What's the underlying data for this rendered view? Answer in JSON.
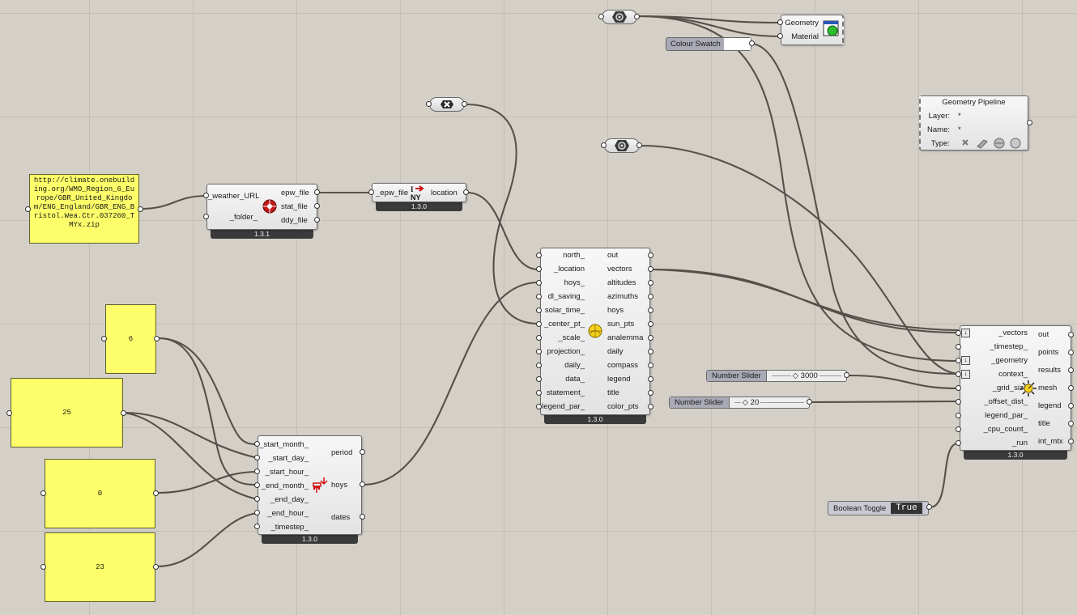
{
  "panels": {
    "url": "http://climate.onebuilding.org/WMO_Region_6_Europe/GBR_United_Kingdom/ENG_England/GBR_ENG_Bristol.Wea.Ctr.037260_TMYx.zip",
    "start_month": "6",
    "start_day": "25",
    "start_hour": "0",
    "end_hour": "23"
  },
  "download": {
    "inputs": [
      "_weather_URL",
      "_folder_"
    ],
    "outputs": [
      "epw_file",
      "stat_file",
      "ddy_file"
    ],
    "version": "1.3.1"
  },
  "import_epw": {
    "input": "_epw_file",
    "output": "location",
    "version": "1.3.0"
  },
  "period": {
    "inputs": [
      "_start_month_",
      "_start_day_",
      "_start_hour_",
      "_end_month_",
      "_end_day_",
      "_end_hour_",
      "_timestep_"
    ],
    "outputs": [
      "period",
      "hoys",
      "dates"
    ],
    "version": "1.3.0"
  },
  "sunpath": {
    "inputs": [
      "north_",
      "_location",
      "hoys_",
      "dl_saving_",
      "solar_time_",
      "_center_pt_",
      "_scale_",
      "projection_",
      "daily_",
      "data_",
      "statement_",
      "legend_par_"
    ],
    "outputs": [
      "out",
      "vectors",
      "altitudes",
      "azimuths",
      "hoys",
      "sun_pts",
      "analemma",
      "daily",
      "compass",
      "legend",
      "title",
      "color_pts"
    ],
    "version": "1.3.0"
  },
  "analysis": {
    "inputs": [
      "_vectors",
      "_timestep_",
      "_geometry",
      "context_",
      "_grid_size",
      "_offset_dist_",
      "legend_par_",
      "_cpu_count_",
      "_run"
    ],
    "outputs": [
      "out",
      "points",
      "results",
      "mesh",
      "legend",
      "title",
      "int_mtx"
    ],
    "version": "1.3.0"
  },
  "preview": {
    "inputs": [
      "Geometry",
      "Material"
    ]
  },
  "colour_swatch": {
    "label": "Colour Swatch"
  },
  "pipeline": {
    "title": "Geometry Pipeline",
    "layer_label": "Layer:",
    "layer_value": "*",
    "name_label": "Name:",
    "name_value": "*",
    "type_label": "Type:"
  },
  "sliders": [
    {
      "label": "Number Slider",
      "value": "3000"
    },
    {
      "label": "Number Slider",
      "value": "20"
    }
  ],
  "toggle": {
    "label": "Boolean Toggle",
    "value": "True"
  },
  "colors": {
    "canvas": "#d4d0c8",
    "panel": "#fefe6a",
    "wire": "#555049"
  },
  "icons": [
    "geometry-param-icon",
    "mesh-param-icon",
    "epw-import-icon",
    "download-weather-icon",
    "analysis-period-icon",
    "sunpath-icon",
    "direct-sun-hours-icon",
    "custom-preview-icon",
    "pipeline-type-icons"
  ]
}
